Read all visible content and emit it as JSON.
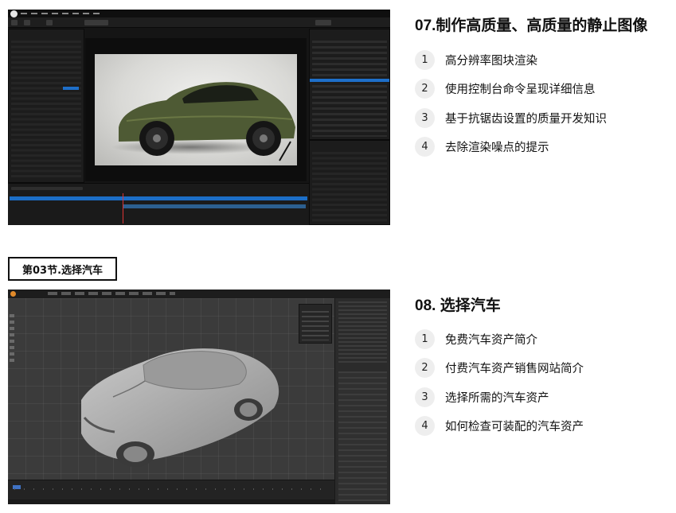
{
  "sections": [
    {
      "title": "07.制作高质量、高质量的静止图像",
      "items": [
        {
          "num": "1",
          "text": "高分辨率图块渲染"
        },
        {
          "num": "2",
          "text": "使用控制台命令呈现详细信息"
        },
        {
          "num": "3",
          "text": "基于抗锯齿设置的质量开发知识"
        },
        {
          "num": "4",
          "text": "去除渲染噪点的提示"
        }
      ]
    },
    {
      "badge": "第03节.选择汽车",
      "title": "08. 选择汽车",
      "items": [
        {
          "num": "1",
          "text": "免费汽车资产简介"
        },
        {
          "num": "2",
          "text": "付费汽车资产销售网站简介"
        },
        {
          "num": "3",
          "text": "选择所需的汽车资产"
        },
        {
          "num": "4",
          "text": "如何检查可装配的汽车资产"
        }
      ]
    }
  ],
  "colors": {
    "olive_car": "#4e5a34",
    "ue_highlight": "#1e6fc9",
    "blender_viewport": "#3b3b3b",
    "number_badge": "#eeeeee"
  },
  "screenshots": [
    {
      "app": "unreal-editor",
      "subject": "green-sports-car-render"
    },
    {
      "app": "blender",
      "subject": "gray-sedan-model"
    }
  ]
}
